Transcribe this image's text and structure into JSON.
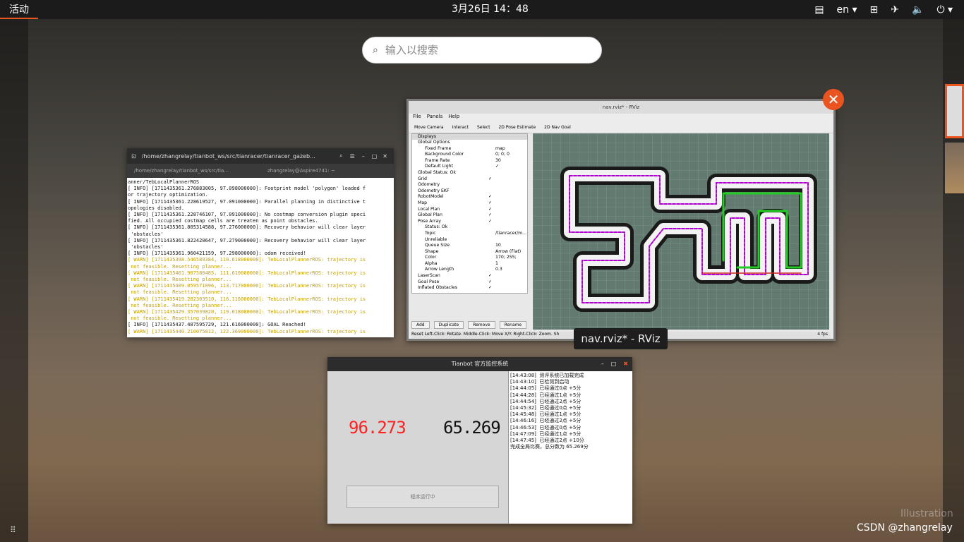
{
  "topbar": {
    "activities": "活动",
    "clock": "3月26日  14：48",
    "lang": "en",
    "icons": [
      "clipboard-icon",
      "network-icon",
      "airplane-icon",
      "volume-icon",
      "power-icon"
    ]
  },
  "search": {
    "placeholder": "输入以搜索"
  },
  "terminal": {
    "title": "/home/zhangrelay/tianbot_ws/src/tianracer/tianracer_gazeb...",
    "tab1": "/home/zhangrelay/tianbot_ws/src/tia...",
    "tab2": "zhangrelay@Aspire4741: ~",
    "lines": [
      {
        "t": "anner/TebLocalPlannerROS",
        "w": false
      },
      {
        "t": "[ INFO] [1711435361.276883005, 97.098000000]: Footprint model 'polygon' loaded f",
        "w": false
      },
      {
        "t": "or trajectory optimization.",
        "w": false
      },
      {
        "t": "[ INFO] [1711435361.228619527, 97.091000000]: Parallel planning in distinctive t",
        "w": false
      },
      {
        "t": "opologies disabled.",
        "w": false
      },
      {
        "t": "[ INFO] [1711435361.228746107, 97.091000000]: No costmap conversion plugin speci",
        "w": false
      },
      {
        "t": "fied. All occupied costmap cells are treaten as point obstacles.",
        "w": false
      },
      {
        "t": "[ INFO] [1711435361.805314588, 97.276000000]: Recovery behavior will clear layer",
        "w": false
      },
      {
        "t": " 'obstacles'",
        "w": false
      },
      {
        "t": "[ INFO] [1711435361.822420647, 97.279000000]: Recovery behavior will clear layer",
        "w": false
      },
      {
        "t": " 'obstacles'",
        "w": false
      },
      {
        "t": "[ INFO] [1711435361.960421159, 97.298000000]: odom received!",
        "w": false
      },
      {
        "t": "[ WARN] [1711435398.546589384, 110.618000000]: TebLocalPlannerROS: trajectory is",
        "w": true
      },
      {
        "t": " not feasible. Resetting planner...",
        "w": true
      },
      {
        "t": "[ WARN] [1711435401.987580485, 111.610000000]: TebLocalPlannerROS: trajectory is",
        "w": true
      },
      {
        "t": " not feasible. Resetting planner...",
        "w": true
      },
      {
        "t": "[ WARN] [1711435409.059571096, 113.717000000]: TebLocalPlannerROS: trajectory is",
        "w": true
      },
      {
        "t": " not feasible. Resetting planner...",
        "w": true
      },
      {
        "t": "[ WARN] [1711435419.282303510, 116.116000000]: TebLocalPlannerROS: trajectory is",
        "w": true
      },
      {
        "t": " not feasible. Resetting planner...",
        "w": true
      },
      {
        "t": "[ WARN] [1711435429.357039820, 119.018000000]: TebLocalPlannerROS: trajectory is",
        "w": true
      },
      {
        "t": " not feasible. Resetting planner...",
        "w": true
      },
      {
        "t": "[ INFO] [1711435437.487595729, 121.616000000]: GOAL Reached!",
        "w": false
      },
      {
        "t": "[ WARN] [1711435440.210075812, 122.369000000]: TebLocalPlannerROS: trajectory is",
        "w": true
      }
    ]
  },
  "rviz": {
    "title": "nav.rviz* - RViz",
    "menu": [
      "File",
      "Panels",
      "Help"
    ],
    "tools": [
      "Move Camera",
      "Interact",
      "Select",
      "2D Pose Estimate",
      "2D Nav Goal"
    ],
    "displays_header": "Displays",
    "rows": [
      {
        "k": "Global Options",
        "v": ""
      },
      {
        "k": "Fixed Frame",
        "v": "map"
      },
      {
        "k": "Background Color",
        "v": "0; 0; 0"
      },
      {
        "k": "Frame Rate",
        "v": "30"
      },
      {
        "k": "Default Light",
        "v": "✓"
      },
      {
        "k": "Global Status: Ok",
        "v": ""
      },
      {
        "k": "Grid",
        "v": "✓"
      },
      {
        "k": "Odometry",
        "v": ""
      },
      {
        "k": "Odometry EKF",
        "v": ""
      },
      {
        "k": "RobotModel",
        "v": "✓"
      },
      {
        "k": "Map",
        "v": "✓"
      },
      {
        "k": "Local Plan",
        "v": "✓"
      },
      {
        "k": "Global Plan",
        "v": "✓"
      },
      {
        "k": "Pose Array",
        "v": "✓"
      },
      {
        "k": "Status: Ok",
        "v": ""
      },
      {
        "k": "Topic",
        "v": "/tianracer/m..."
      },
      {
        "k": "Unreliable",
        "v": ""
      },
      {
        "k": "Queue Size",
        "v": "10"
      },
      {
        "k": "Shape",
        "v": "Arrow (Flat)"
      },
      {
        "k": "Color",
        "v": "170; 255;"
      },
      {
        "k": "Alpha",
        "v": "1"
      },
      {
        "k": "Arrow Length",
        "v": "0.3"
      },
      {
        "k": "LaserScan",
        "v": "✓"
      },
      {
        "k": "Goal Pose",
        "v": "✓"
      },
      {
        "k": "Inflated Obstacles",
        "v": "✓"
      }
    ],
    "buttons": [
      "Add",
      "Duplicate",
      "Remove",
      "Rename"
    ],
    "status": "Reset   Left-Click: Rotate.  Middle-Click: Move X/Y.  Right-Click: Zoom. Sh",
    "fps": "4 fps",
    "tooltip": "nav.rviz* - RViz"
  },
  "tianbot": {
    "title": "Tianbot 官方监控系统",
    "score_red": "96.273",
    "score_black": "65.269",
    "run_button": "程序运行中",
    "log": [
      "[14:43:08]  测评系统已加载完成",
      "[14:43:10]  已检测到启动",
      "[14:44:05]  已经通过0点 +5分",
      "[14:44:28]  已经通过1点 +5分",
      "[14:44:54]  已经通过2点 +5分",
      "[14:45:32]  已经通过0点 +5分",
      "[14:45:48]  已经通过1点 +5分",
      "[14:46:16]  已经通过2点 +5分",
      "[14:46:53]  已经通过0点 +5分",
      "[14:47:09]  已经通过1点 +5分",
      "[14:47:45]  已经通过2点 +10分",
      "完成全局比赛，总分数为 65.269分"
    ]
  },
  "watermark": "CSDN @zhangrelay",
  "illustration": "Illustration"
}
